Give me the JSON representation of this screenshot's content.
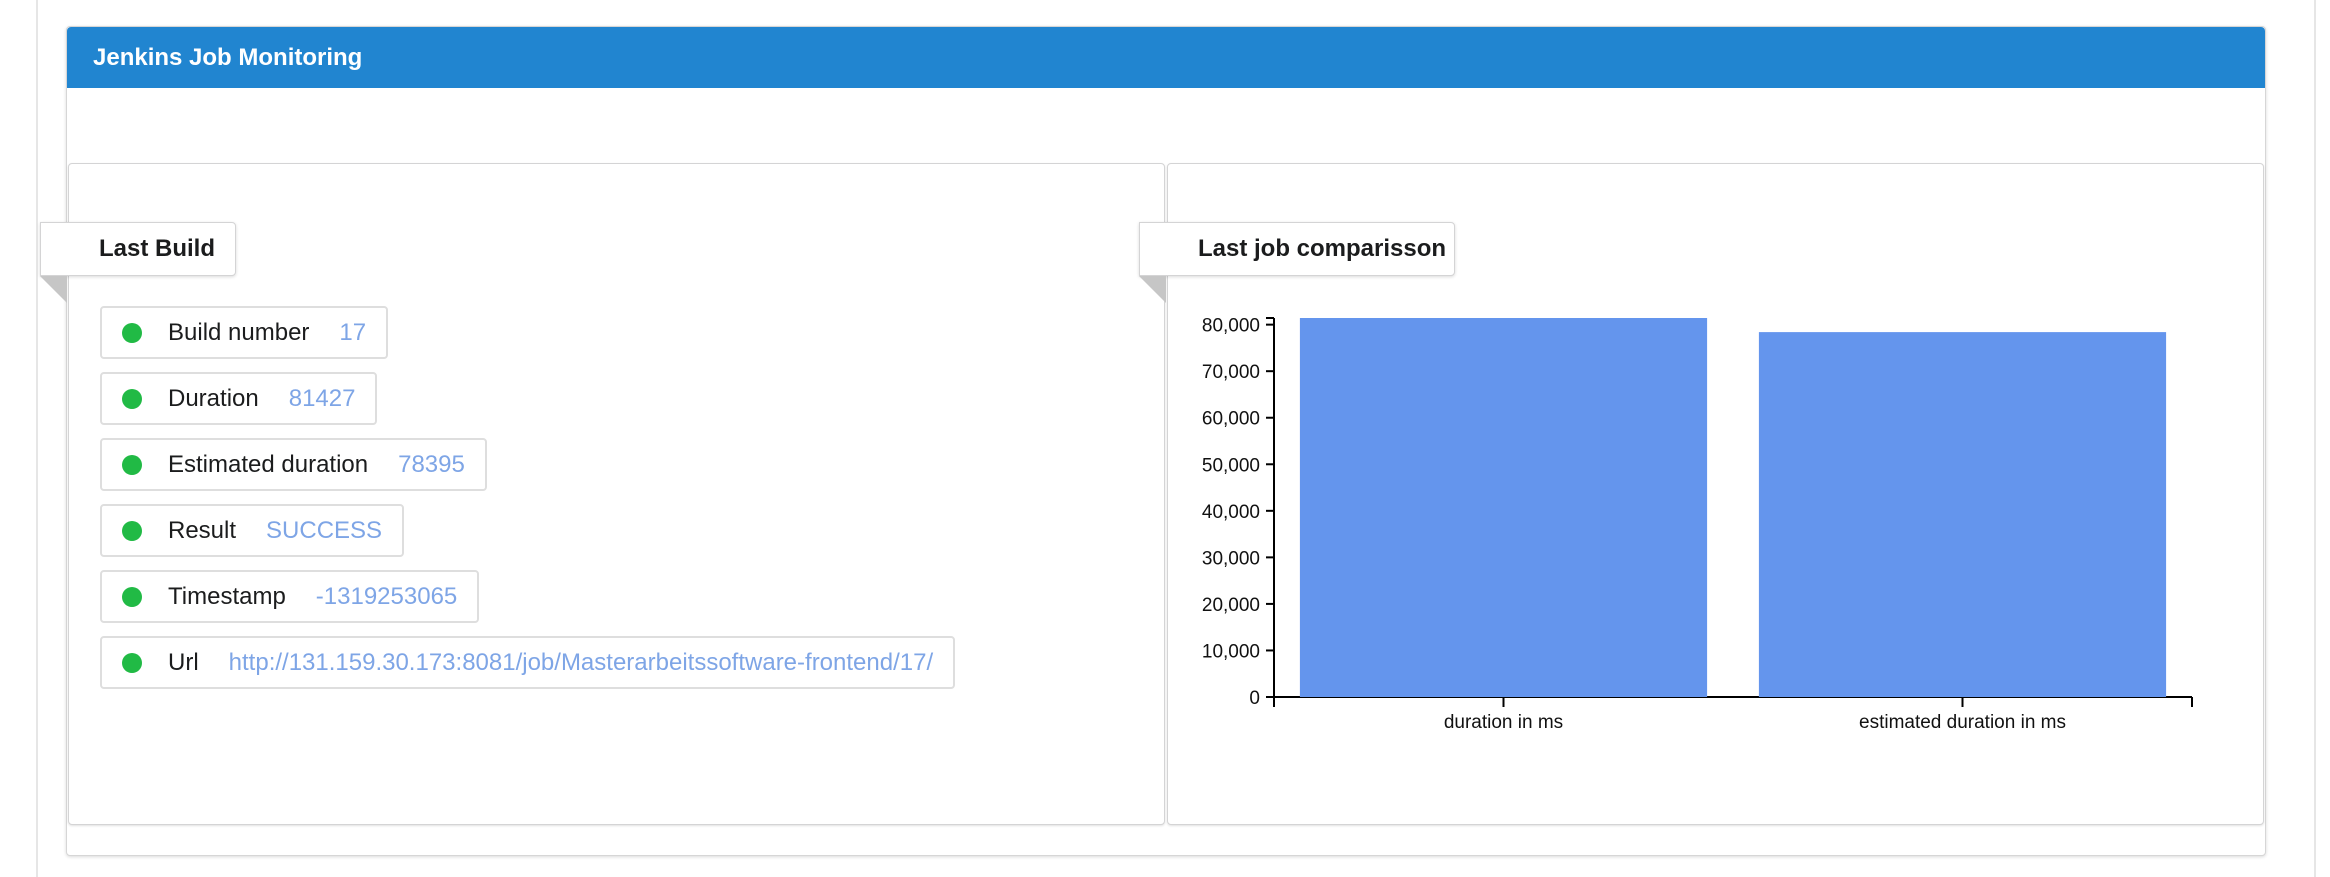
{
  "header": {
    "title": "Jenkins Job Monitoring"
  },
  "last_build": {
    "title": "Last Build",
    "items": [
      {
        "label": "Build number",
        "value": "17"
      },
      {
        "label": "Duration",
        "value": "81427"
      },
      {
        "label": "Estimated duration",
        "value": "78395"
      },
      {
        "label": "Result",
        "value": "SUCCESS"
      },
      {
        "label": "Timestamp",
        "value": "-1319253065"
      },
      {
        "label": "Url",
        "value": "http://131.159.30.173:8081/job/Masterarbeitssoftware-frontend/17/"
      }
    ]
  },
  "comparison": {
    "title": "Last job comparisson"
  },
  "colors": {
    "header": "#2185d0",
    "status_dot": "#21ba45",
    "value_text": "#7ea5e6",
    "bar": "#6495ed"
  },
  "chart_data": {
    "type": "bar",
    "categories": [
      "duration in ms",
      "estimated duration in ms"
    ],
    "values": [
      81427,
      78395
    ],
    "yticks": [
      "0",
      "10,000",
      "20,000",
      "30,000",
      "40,000",
      "50,000",
      "60,000",
      "70,000",
      "80,000"
    ],
    "ylim": [
      0,
      81427
    ],
    "grid": false,
    "legend": "none"
  }
}
